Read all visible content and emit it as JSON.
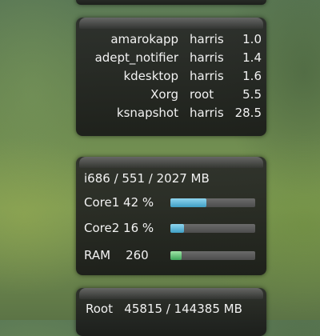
{
  "processes": {
    "rows": [
      {
        "name": "amarokapp",
        "user": "harris",
        "cpu": "1.0"
      },
      {
        "name": "adept_notifier",
        "user": "harris",
        "cpu": "1.4"
      },
      {
        "name": "kdesktop",
        "user": "harris",
        "cpu": "1.6"
      },
      {
        "name": "Xorg",
        "user": "root",
        "cpu": "5.5"
      },
      {
        "name": "ksnapshot",
        "user": "harris",
        "cpu": "28.5"
      }
    ]
  },
  "system": {
    "summary": "i686  /  551 / 2027 MB",
    "meters": [
      {
        "label": "Core1  42 %",
        "value": 0.42,
        "kind": "cpu"
      },
      {
        "label": "Core2  16 %",
        "value": 0.16,
        "kind": "cpu"
      },
      {
        "label": "RAM    260",
        "value": 0.128,
        "kind": "ram"
      }
    ]
  },
  "disk": {
    "summary": "Root   45815 / 144385 MB"
  },
  "colors": {
    "cpu_bar": "#3f9fc4",
    "ram_bar": "#3ea65a"
  }
}
